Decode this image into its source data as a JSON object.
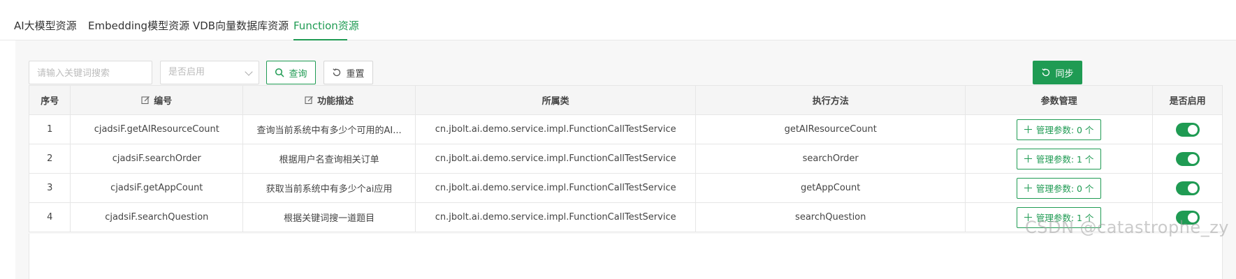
{
  "tabs": [
    {
      "label": "AI大模型资源",
      "active": false
    },
    {
      "label": "Embedding模型资源",
      "active": false
    },
    {
      "label": "VDB向量数据库资源",
      "active": false
    },
    {
      "label": "Function资源",
      "active": true
    }
  ],
  "toolbar": {
    "keyword_placeholder": "请输入关键词搜索",
    "enabled_select_placeholder": "是否启用",
    "query_label": "查询",
    "reset_label": "重置",
    "sync_label": "同步"
  },
  "table": {
    "headers": {
      "index": "序号",
      "code": "编号",
      "description": "功能描述",
      "class": "所属类",
      "method": "执行方法",
      "params": "参数管理",
      "enabled": "是否启用"
    },
    "rows": [
      {
        "index": "1",
        "code": "cjadsiF.getAIResourceCount",
        "description": "查询当前系统中有多少个可用的AI...",
        "class": "cn.jbolt.ai.demo.service.impl.FunctionCallTestService",
        "method": "getAIResourceCount",
        "params_label": "管理参数: 0 个",
        "enabled": true
      },
      {
        "index": "2",
        "code": "cjadsiF.searchOrder",
        "description": "根据用户名查询相关订单",
        "class": "cn.jbolt.ai.demo.service.impl.FunctionCallTestService",
        "method": "searchOrder",
        "params_label": "管理参数: 1 个",
        "enabled": true
      },
      {
        "index": "3",
        "code": "cjadsiF.getAppCount",
        "description": "获取当前系统中有多少个ai应用",
        "class": "cn.jbolt.ai.demo.service.impl.FunctionCallTestService",
        "method": "getAppCount",
        "params_label": "管理参数: 0 个",
        "enabled": true
      },
      {
        "index": "4",
        "code": "cjadsiF.searchQuestion",
        "description": "根据关键词搜一道题目",
        "class": "cn.jbolt.ai.demo.service.impl.FunctionCallTestService",
        "method": "searchQuestion",
        "params_label": "管理参数: 1 个",
        "enabled": true
      }
    ]
  },
  "watermark": "CSDN @catastrophe_zy",
  "colors": {
    "accent": "#1f9b53",
    "header_bg": "#f5f5f5",
    "panel_bg": "#f7f7f7"
  }
}
